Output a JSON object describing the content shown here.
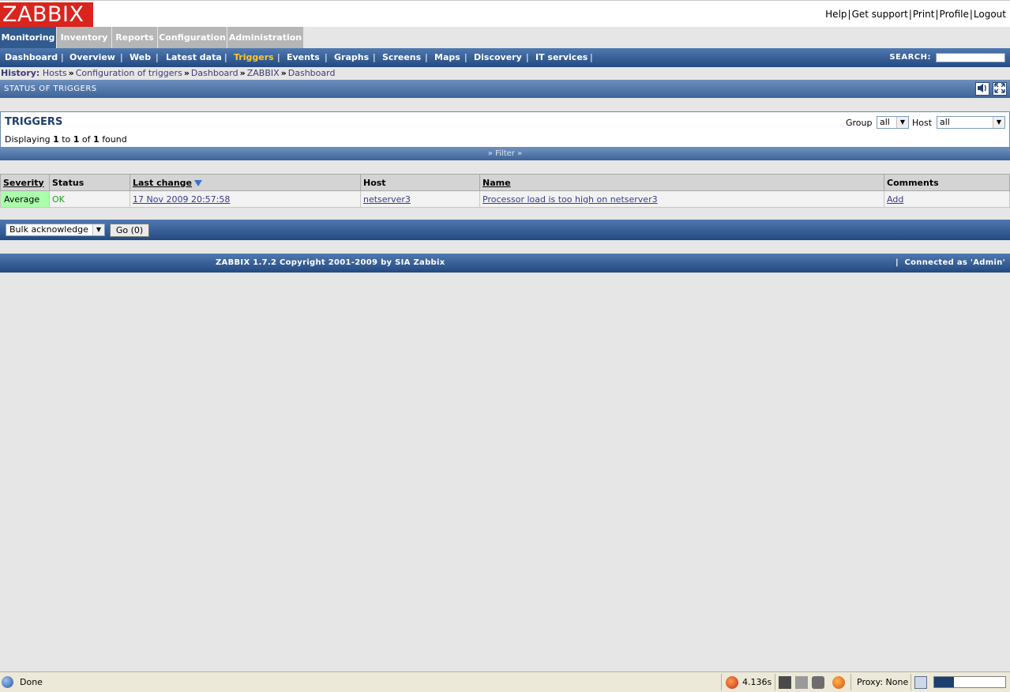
{
  "header": {
    "logo": "ZABBIX",
    "links": [
      "Help",
      "Get support",
      "Print",
      "Profile",
      "Logout"
    ]
  },
  "main_tabs": [
    "Monitoring",
    "Inventory",
    "Reports",
    "Configuration",
    "Administration"
  ],
  "submenu": {
    "items": [
      "Dashboard",
      "Overview",
      "Web",
      "Latest data",
      "Triggers",
      "Events",
      "Graphs",
      "Screens",
      "Maps",
      "Discovery",
      "IT services"
    ],
    "active": "Triggers",
    "search_label": "SEARCH:",
    "search_value": ""
  },
  "history": {
    "label": "History:",
    "items": [
      "Hosts",
      "Configuration of triggers",
      "Dashboard",
      "ZABBIX",
      "Dashboard"
    ]
  },
  "status_bar": {
    "title": "STATUS OF TRIGGERS",
    "sound_icon": "speaker-icon",
    "fullscreen_icon": "fullscreen-icon"
  },
  "triggers_box": {
    "title": "TRIGGERS",
    "displaying_prefix": "Displaying",
    "from": "1",
    "to_word": "to",
    "to": "1",
    "of_word": "of",
    "total": "1",
    "found": "found",
    "group_label": "Group",
    "group_value": "all",
    "host_label": "Host",
    "host_value": "all"
  },
  "filter": {
    "label": "Filter"
  },
  "table": {
    "headers": [
      "Severity",
      "Status",
      "Last change",
      "Host",
      "Name",
      "Comments"
    ],
    "rows": [
      {
        "severity": "Average",
        "status": "OK",
        "last_change": "17 Nov 2009 20:57:58",
        "host": "netserver3",
        "name": "Processor load is too high on netserver3",
        "comments": "Add"
      }
    ]
  },
  "bulk": {
    "select_value": "Bulk acknowledge",
    "go_label": "Go (0)"
  },
  "footer": {
    "copyright": "ZABBIX 1.7.2 Copyright 2001-2009 by  SIA Zabbix",
    "separator": "|",
    "connected": "Connected as 'Admin'"
  },
  "browser_status": {
    "text": "Done",
    "timing": "4.136s",
    "proxy": "Proxy: None",
    "progress": 0.28
  },
  "colors": {
    "logo": "#d9251d",
    "nav_blue": "#315a8e",
    "active_submenu": "#ffc82c",
    "severity_average": "#aaffaa",
    "status_ok": "#13a613"
  }
}
